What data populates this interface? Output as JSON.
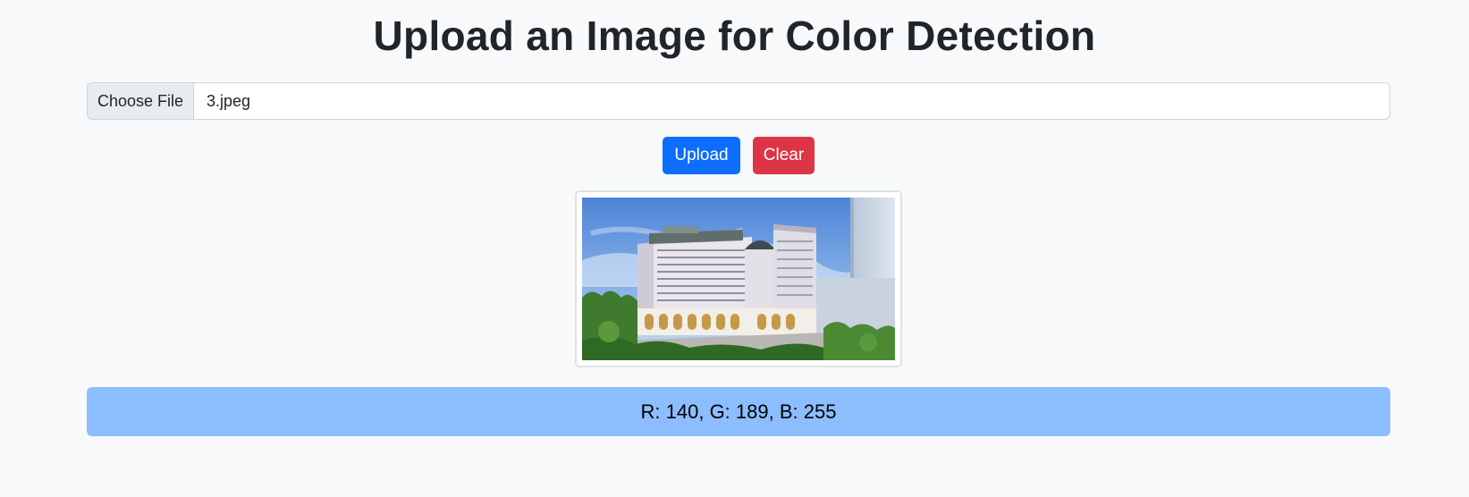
{
  "page": {
    "title": "Upload an Image for Color Detection"
  },
  "file_input": {
    "button_label": "Choose File",
    "file_name": "3.jpeg"
  },
  "actions": {
    "upload_label": "Upload",
    "clear_label": "Clear"
  },
  "preview": {
    "image_subject": "building-photo"
  },
  "result": {
    "text": "R: 140, G: 189, B: 255",
    "color": "#8cbdff"
  },
  "colors": {
    "primary": "#0d6efd",
    "danger": "#dc3545",
    "background": "#f8f9fa"
  }
}
